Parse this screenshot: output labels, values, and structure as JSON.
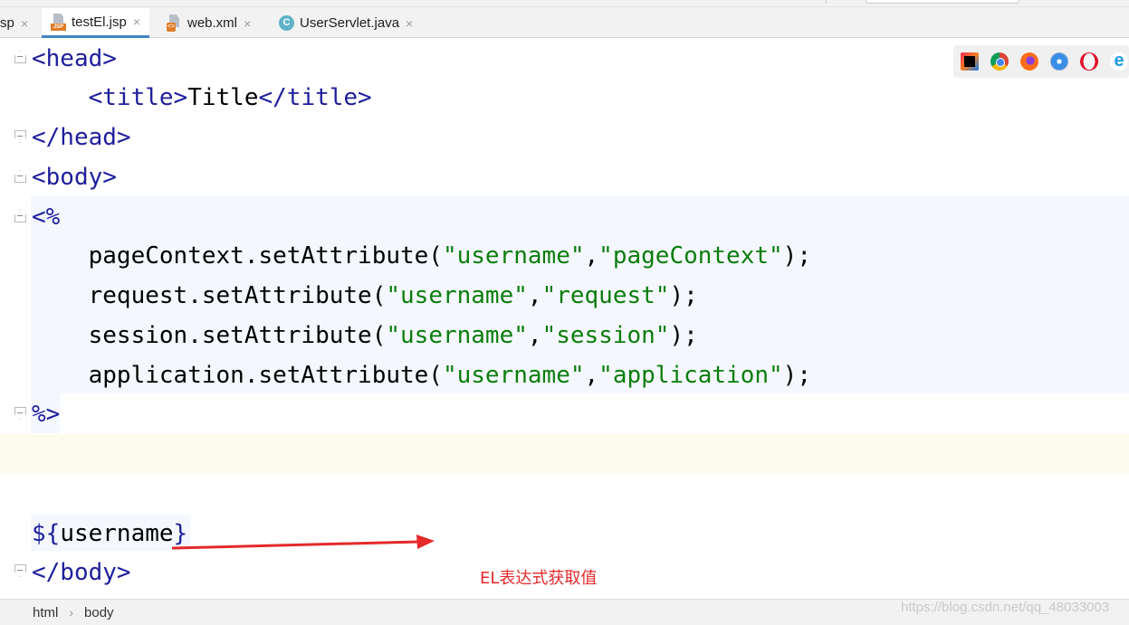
{
  "tabs": [
    {
      "label": "sp",
      "icon": "none",
      "active": false
    },
    {
      "label": "testEl.jsp",
      "icon": "jsp-file-icon",
      "icon_text": "JSP",
      "active": true
    },
    {
      "label": "web.xml",
      "icon": "xml-file-icon",
      "icon_text": "<>",
      "active": false
    },
    {
      "label": "UserServlet.java",
      "icon": "java-class-icon",
      "icon_text": "C",
      "active": false
    }
  ],
  "close_glyph": "×",
  "code": {
    "head_open": "<head>",
    "title_open": "<title>",
    "title_text": "Title",
    "title_close": "</title>",
    "head_close": "</head>",
    "body_open": "<body>",
    "scriptlet_open": "<%",
    "lines": [
      {
        "obj": "pageContext",
        "method": ".setAttribute(",
        "key": "\"username\"",
        "comma": ",",
        "val": "\"pageContext\"",
        "end": ");"
      },
      {
        "obj": "request",
        "method": ".setAttribute(",
        "key": "\"username\"",
        "comma": ",",
        "val": "\"request\"",
        "end": ");"
      },
      {
        "obj": "session",
        "method": ".setAttribute(",
        "key": "\"username\"",
        "comma": ",",
        "val": "\"session\"",
        "end": ");"
      },
      {
        "obj": "application",
        "method": ".setAttribute(",
        "key": "\"username\"",
        "comma": ",",
        "val": "\"application\"",
        "end": ");"
      }
    ],
    "scriptlet_close": "%>",
    "el_open": "${",
    "el_var": "username",
    "el_close": "}",
    "body_close": "</body>"
  },
  "browser_icons": [
    "intellij-icon",
    "chrome-icon",
    "firefox-icon",
    "safari-icon",
    "opera-icon",
    "ie-icon"
  ],
  "annotation": {
    "text": "EL表达式获取值",
    "color": "#e5292a"
  },
  "breadcrumb": [
    "html",
    "body"
  ],
  "watermark": "https://blog.csdn.net/qq_48033003"
}
